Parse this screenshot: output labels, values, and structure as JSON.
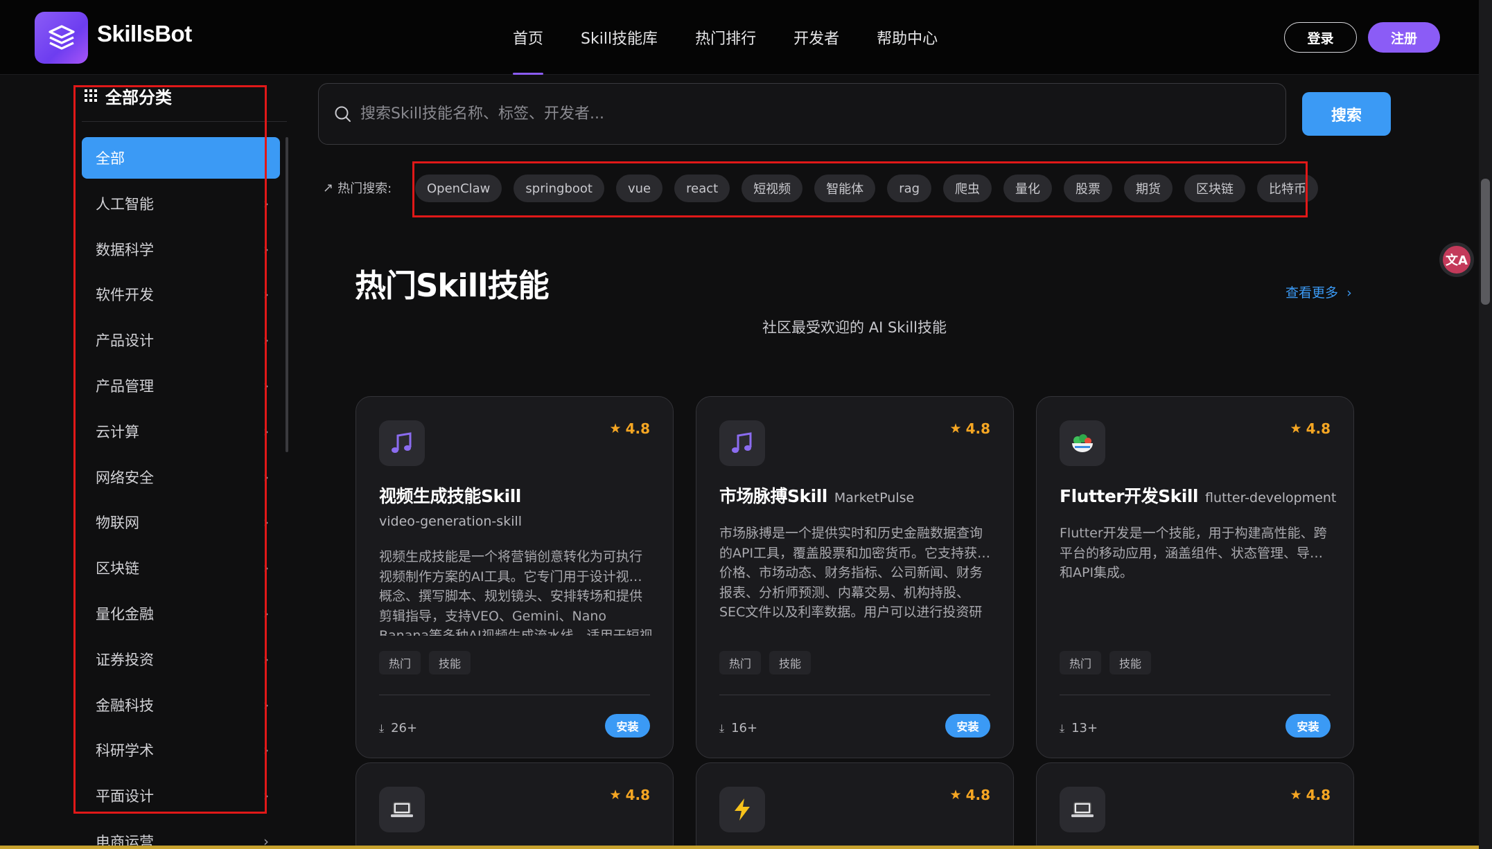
{
  "header": {
    "logo_text": "SkillsBot",
    "nav": [
      "首页",
      "Skill技能库",
      "热门排行",
      "开发者",
      "帮助中心"
    ],
    "active_nav": "首页",
    "login_label": "登录",
    "register_label": "注册"
  },
  "sidebar": {
    "title": "全部分类",
    "items": [
      "全部",
      "人工智能",
      "数据科学",
      "软件开发",
      "产品设计",
      "产品管理",
      "云计算",
      "网络安全",
      "物联网",
      "区块链",
      "量化金融",
      "证券投资",
      "金融科技",
      "科研学术",
      "平面设计",
      "电商运营"
    ],
    "active": "全部"
  },
  "search": {
    "placeholder": "搜索Skill技能名称、标签、开发者...",
    "button_label": "搜索",
    "hot_label": "热门搜索:",
    "hot_tags": [
      "OpenClaw",
      "springboot",
      "vue",
      "react",
      "短视频",
      "智能体",
      "rag",
      "爬虫",
      "量化",
      "股票",
      "期货",
      "区块链",
      "比特币"
    ]
  },
  "section": {
    "title": "热门Skill技能",
    "more_label": "查看更多",
    "subtitle": "社区最受欢迎的 AI Skill技能"
  },
  "cards": [
    {
      "icon": "music-note-icon",
      "rating": "4.8",
      "name": "视频生成技能Skill",
      "alias": "",
      "slug": "video-generation-skill",
      "description": "视频生成技能是一个将营销创意转化为可执行视频制作方案的AI工具。它专门用于设计视…概念、撰写脚本、规划镜头、安排转场和提供剪辑指导，支持VEO、Gemini、Nano Banana等多种AI视频生成流水线，适用于短视频（如",
      "badges": [
        "热门",
        "技能"
      ],
      "downloads": "26+",
      "install_label": "安装"
    },
    {
      "icon": "music-note-icon",
      "rating": "4.8",
      "name": "市场脉搏Skill",
      "alias": "MarketPulse",
      "slug": "",
      "description": "市场脉搏是一个提供实时和历史金融数据查询的API工具，覆盖股票和加密货币。它支持获…价格、市场动态、财务指标、公司新闻、财务报表、分析师预测、内幕交易、机构持股、SEC文件以及利率数据。用户可以进行投资研究、跨资产组合分析、市场筛选、财报分析和",
      "badges": [
        "热门",
        "技能"
      ],
      "downloads": "16+",
      "install_label": "安装"
    },
    {
      "icon": "salad-bowl-icon",
      "rating": "4.8",
      "name": "Flutter开发Skill",
      "alias": "flutter-development",
      "slug": "",
      "description": "Flutter开发是一个技能，用于构建高性能、跨平台的移动应用，涵盖组件、状态管理、导…和API集成。",
      "badges": [
        "热门",
        "技能"
      ],
      "downloads": "13+",
      "install_label": "安装"
    },
    {
      "icon": "laptop-icon",
      "rating": "4.8"
    },
    {
      "icon": "lightning-icon",
      "rating": "4.8"
    },
    {
      "icon": "laptop-icon",
      "rating": "4.8"
    }
  ],
  "colors": {
    "accent_purple": "#8b5cf6",
    "accent_blue": "#3b9af5",
    "star": "#f5a623",
    "annotation_red": "#e01818"
  }
}
